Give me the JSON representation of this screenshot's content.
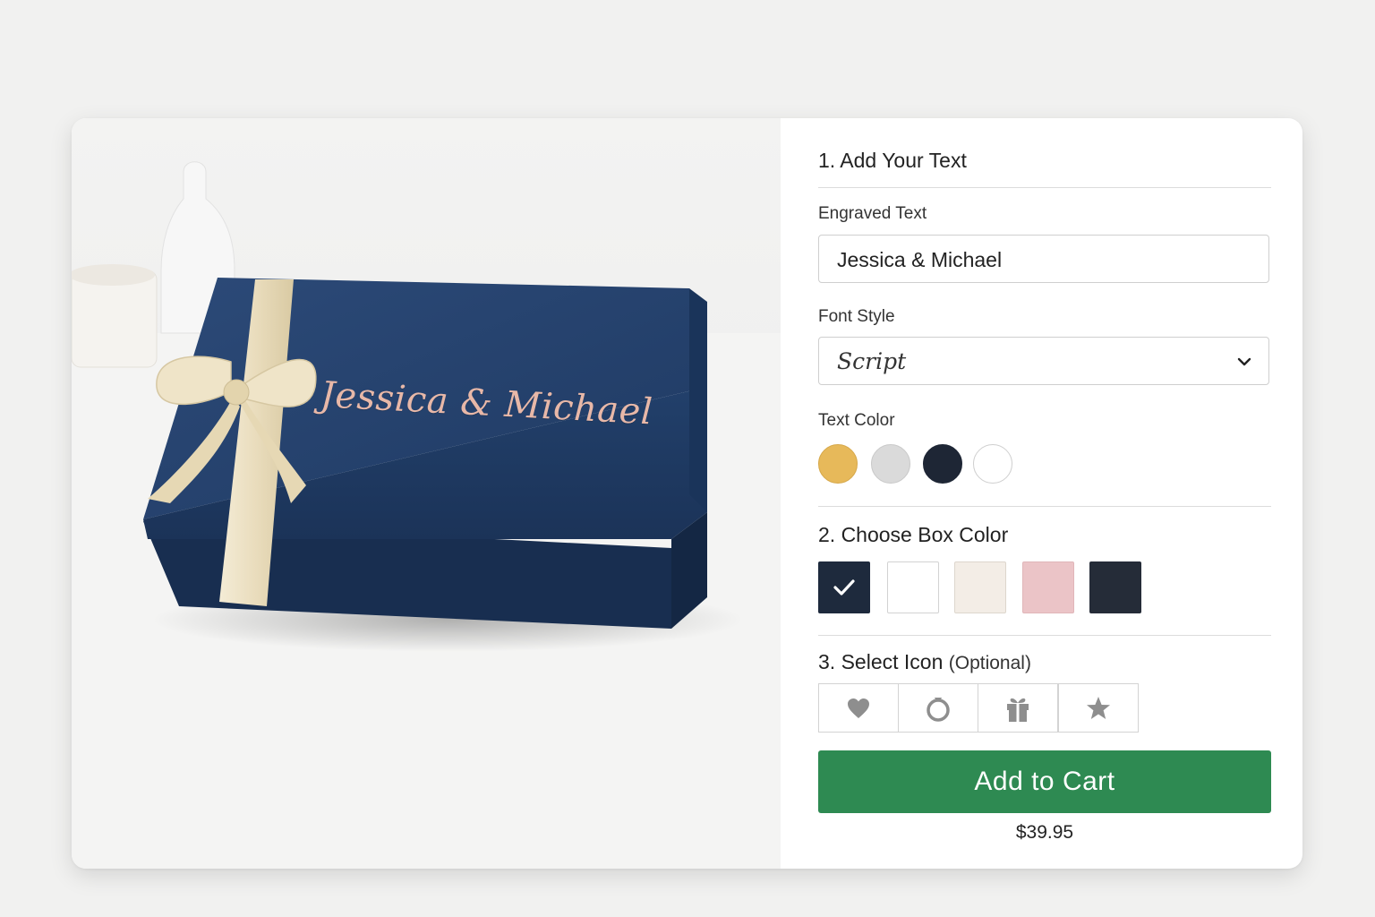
{
  "preview": {
    "engraved_text": "Jessica & Michael"
  },
  "step1": {
    "title": "1. Add Your Text",
    "engraved_label": "Engraved Text",
    "engraved_value": "Jessica & Michael",
    "font_label": "Font Style",
    "font_value": "Script",
    "text_color_label": "Text Color",
    "text_colors": [
      "#e7b95a",
      "#dadada",
      "#1e2635",
      "#ffffff"
    ]
  },
  "step2": {
    "title": "2. Choose Box Color",
    "box_colors": [
      "#1e2a3d",
      "#ffffff",
      "#f3ede6",
      "#ebc4c7",
      "#252c38"
    ],
    "selected_index": 0
  },
  "step3": {
    "title": "3. Select Icon",
    "optional": "(Optional)",
    "icons": [
      "heart-icon",
      "ring-icon",
      "gift-icon",
      "star-icon"
    ]
  },
  "cart": {
    "button_label": "Add to Cart",
    "price": "$39.95",
    "accent": "#2e8a52"
  }
}
